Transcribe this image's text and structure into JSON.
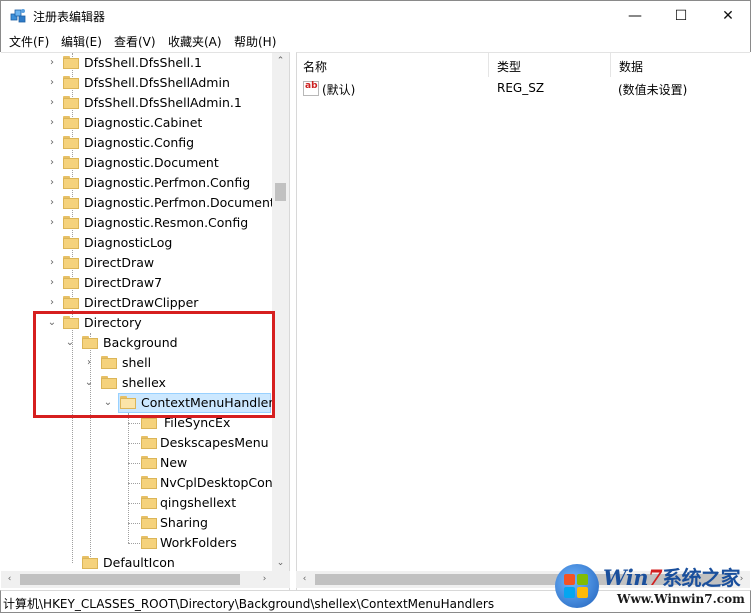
{
  "window": {
    "title": "注册表编辑器",
    "minimize_glyph": "—",
    "maximize_glyph": "☐",
    "close_glyph": "✕"
  },
  "menu": [
    "文件(F)",
    "编辑(E)",
    "查看(V)",
    "收藏夹(A)",
    "帮助(H)"
  ],
  "tree": [
    {
      "label": "DfsShell.DfsShell.1",
      "expander": "›"
    },
    {
      "label": "DfsShell.DfsShellAdmin",
      "expander": "›"
    },
    {
      "label": "DfsShell.DfsShellAdmin.1",
      "expander": "›"
    },
    {
      "label": "Diagnostic.Cabinet",
      "expander": "›"
    },
    {
      "label": "Diagnostic.Config",
      "expander": "›"
    },
    {
      "label": "Diagnostic.Document",
      "expander": "›"
    },
    {
      "label": "Diagnostic.Perfmon.Config",
      "expander": "›"
    },
    {
      "label": "Diagnostic.Perfmon.Document",
      "expander": "›"
    },
    {
      "label": "Diagnostic.Resmon.Config",
      "expander": "›"
    },
    {
      "label": "DiagnosticLog",
      "expander": ""
    },
    {
      "label": "DirectDraw",
      "expander": "›"
    },
    {
      "label": "DirectDraw7",
      "expander": "›"
    },
    {
      "label": "DirectDrawClipper",
      "expander": "›"
    },
    {
      "label": "Directory",
      "expander": "⌄"
    },
    {
      "label": "Background",
      "expander": "⌄"
    },
    {
      "label": "shell",
      "expander": "›"
    },
    {
      "label": "shellex",
      "expander": "⌄"
    },
    {
      "label": "ContextMenuHandlers",
      "expander": "⌄"
    },
    {
      "label": "FileSyncEx",
      "expander": ""
    },
    {
      "label": "DeskscapesMenu",
      "expander": ""
    },
    {
      "label": "New",
      "expander": ""
    },
    {
      "label": "NvCplDesktopConte",
      "expander": ""
    },
    {
      "label": "qingshellext",
      "expander": ""
    },
    {
      "label": "Sharing",
      "expander": ""
    },
    {
      "label": "WorkFolders",
      "expander": ""
    },
    {
      "label": "DefaultIcon",
      "expander": ""
    }
  ],
  "list": {
    "columns": [
      "名称",
      "类型",
      "数据"
    ],
    "rows": [
      {
        "name": "(默认)",
        "type": "REG_SZ",
        "data": "(数值未设置)",
        "icon_text": "ab"
      }
    ]
  },
  "scroll_glyphs": {
    "up": "⌃",
    "down": "⌄",
    "left": "‹",
    "right": "›"
  },
  "status": {
    "path": "计算机\\HKEY_CLASSES_ROOT\\Directory\\Background\\shellex\\ContextMenuHandlers"
  },
  "watermark": {
    "brand_prefix": "Win",
    "brand_seven": "7",
    "brand_cn": "系统之家",
    "url": "Www.Winwin7.com"
  },
  "colors": {
    "selection": "#cce8ff",
    "highlight_border": "#d61f1f",
    "folder": "#f5d27c"
  }
}
